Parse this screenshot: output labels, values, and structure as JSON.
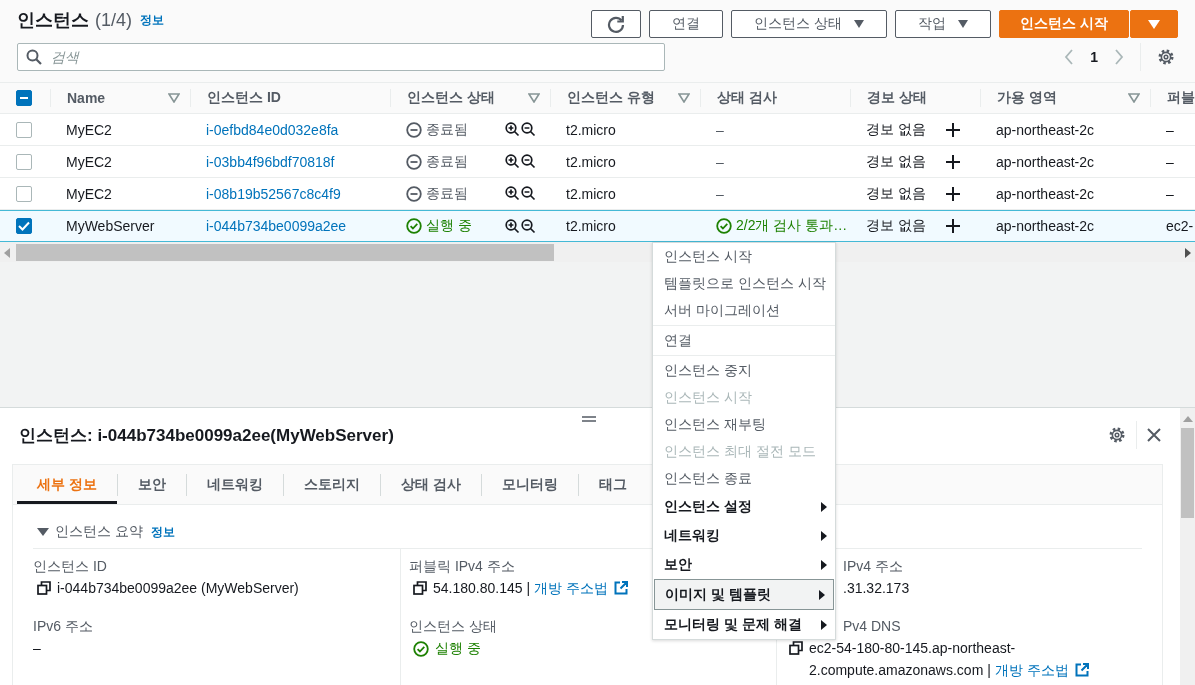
{
  "header": {
    "title": "인스턴스",
    "count": "(1/4)",
    "info_link": "정보",
    "buttons": [
      {
        "kind": "refresh"
      },
      {
        "kind": "plain",
        "label": "연결"
      },
      {
        "kind": "dropdown",
        "label": "인스턴스 상태"
      },
      {
        "kind": "dropdown",
        "label": "작업"
      },
      {
        "kind": "primary",
        "label": "인스턴스 시작"
      },
      {
        "kind": "primary-caret"
      }
    ]
  },
  "search": {
    "placeholder": "검색"
  },
  "pagination": {
    "page": "1"
  },
  "table": {
    "select_all": {
      "indeterminate": true
    },
    "columns": [
      {
        "label": "Name",
        "sort_icon": true
      },
      {
        "label": "인스턴스 ID",
        "sort_icon": false
      },
      {
        "label": "인스턴스 상태",
        "sort_icon": true
      },
      {
        "label": "인스턴스 유형",
        "sort_icon": true
      },
      {
        "label": "상태 검사",
        "sort_icon": false
      },
      {
        "label": "경보 상태",
        "sort_icon": false
      },
      {
        "label": "가용 영역",
        "sort_icon": true
      },
      {
        "label": "퍼블",
        "sort_icon": false
      }
    ],
    "rows": [
      {
        "selected": false,
        "name": "MyEC2",
        "id": "i-0efbd84e0d032e8fa",
        "running": false,
        "state_label": "종료됨",
        "type": "t2.micro",
        "check_passed": false,
        "check": "–",
        "alarm": "경보 없음",
        "az": "ap-northeast-2c",
        "public": "–"
      },
      {
        "selected": false,
        "name": "MyEC2",
        "id": "i-03bb4f96bdf70818f",
        "running": false,
        "state_label": "종료됨",
        "type": "t2.micro",
        "check_passed": false,
        "check": "–",
        "alarm": "경보 없음",
        "az": "ap-northeast-2c",
        "public": "–"
      },
      {
        "selected": false,
        "name": "MyEC2",
        "id": "i-08b19b52567c8c4f9",
        "running": false,
        "state_label": "종료됨",
        "type": "t2.micro",
        "check_passed": false,
        "check": "–",
        "alarm": "경보 없음",
        "az": "ap-northeast-2c",
        "public": "–"
      },
      {
        "selected": true,
        "name": "MyWebServer",
        "id": "i-044b734be0099a2ee",
        "running": true,
        "state_label": "실행 중",
        "type": "t2.micro",
        "check_passed": true,
        "check": "2/2개 검사 통과…",
        "alarm": "경보 없음",
        "az": "ap-northeast-2c",
        "public": "ec2-"
      }
    ]
  },
  "details": {
    "title_prefix": "인스턴스:",
    "title": "i-044b734be0099a2ee(MyWebServer)",
    "tabs": [
      {
        "label": "세부 정보",
        "selected": true
      },
      {
        "label": "보안",
        "selected": false
      },
      {
        "label": "네트워킹",
        "selected": false
      },
      {
        "label": "스토리지",
        "selected": false
      },
      {
        "label": "상태 검사",
        "selected": false
      },
      {
        "label": "모니터링",
        "selected": false
      },
      {
        "label": "태그",
        "selected": false
      }
    ],
    "section": {
      "title": "인스턴스 요약",
      "info_link": "정보",
      "expanded": true
    },
    "columns": [
      [
        {
          "label": "인스턴스 ID",
          "value": "i-044b734be0099a2ee (MyWebServer)",
          "copy": true,
          "running": false
        },
        {
          "label": "IPv6 주소",
          "value": "–",
          "copy": false,
          "running": false
        }
      ],
      [
        {
          "label": "퍼블릭 IPv4 주소",
          "value": "54.180.80.145 |",
          "copy": true,
          "link": "개방 주소법",
          "running": false
        },
        {
          "label": "인스턴스 상태",
          "value": "실행 중",
          "copy": false,
          "running": true
        }
      ],
      [
        {
          "label": "IPv4 주소",
          "value": ".31.32.173",
          "copy": false,
          "running": false,
          "partly_hidden": true
        },
        {
          "label": "Pv4 DNS",
          "value": "ec2-54-180-80-145.ap-northeast-2.compute.amazonaws.com |",
          "copy": true,
          "link": "개방 주소법",
          "running": false,
          "partly_hidden": true
        }
      ]
    ]
  },
  "context_menu": {
    "groups": [
      [
        {
          "label": "인스턴스 시작",
          "disabled": false,
          "submenu": false,
          "selected": false
        },
        {
          "label": "템플릿으로 인스턴스 시작",
          "disabled": false,
          "submenu": false,
          "selected": false
        },
        {
          "label": "서버 마이그레이션",
          "disabled": false,
          "submenu": false,
          "selected": false
        }
      ],
      [
        {
          "label": "연결",
          "disabled": false,
          "submenu": false,
          "selected": false
        }
      ],
      [
        {
          "label": "인스턴스 중지",
          "disabled": false,
          "submenu": false,
          "selected": false
        },
        {
          "label": "인스턴스 시작",
          "disabled": true,
          "submenu": false,
          "selected": false
        },
        {
          "label": "인스턴스 재부팅",
          "disabled": false,
          "submenu": false,
          "selected": false
        },
        {
          "label": "인스턴스 최대 절전 모드",
          "disabled": true,
          "submenu": false,
          "selected": false
        },
        {
          "label": "인스턴스 종료",
          "disabled": false,
          "submenu": false,
          "selected": false
        },
        {
          "label": "인스턴스 설정",
          "disabled": false,
          "submenu": true,
          "selected": false
        },
        {
          "label": "네트워킹",
          "disabled": false,
          "submenu": true,
          "selected": false
        },
        {
          "label": "보안",
          "disabled": false,
          "submenu": true,
          "selected": false
        },
        {
          "label": "이미지 및 템플릿",
          "disabled": false,
          "submenu": true,
          "selected": true
        },
        {
          "label": "모니터링 및 문제 해결",
          "disabled": false,
          "submenu": true,
          "selected": false
        }
      ]
    ]
  }
}
